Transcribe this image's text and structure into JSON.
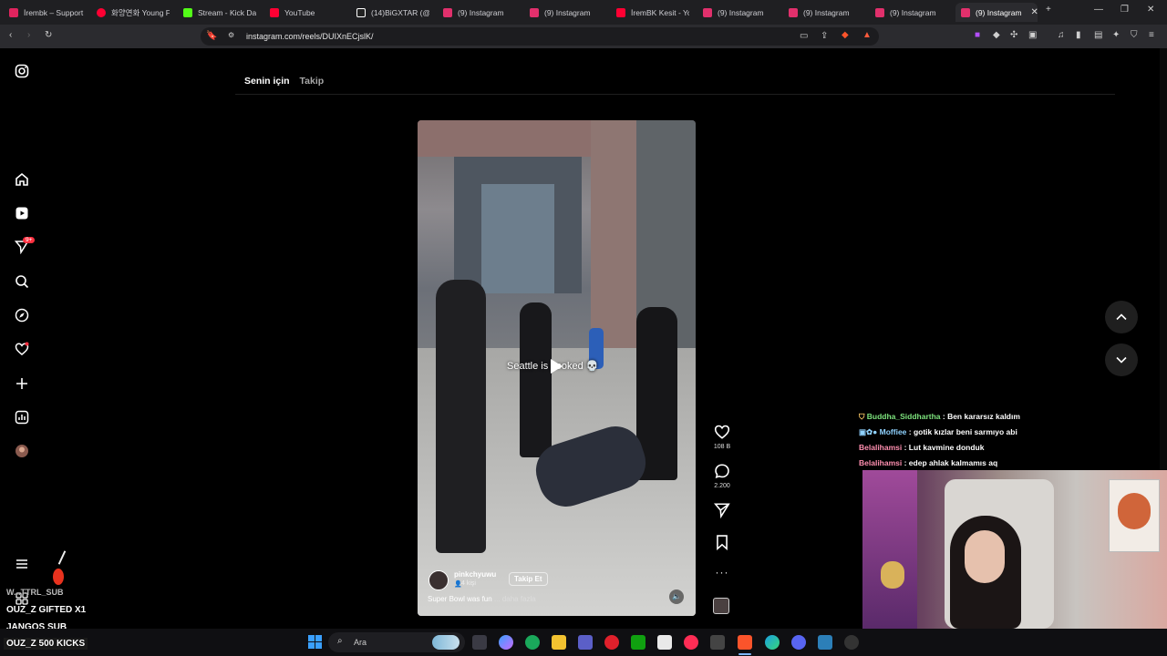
{
  "browser": {
    "tabs": [
      {
        "label": "İrembk – Support",
        "color": "#e0245e"
      },
      {
        "label": "화양연화 Young F",
        "color": "#ff0033"
      },
      {
        "label": "Stream - Kick Da",
        "color": "#53fc18"
      },
      {
        "label": "YouTube",
        "color": "#ff0033"
      },
      {
        "label": "(14)BiGXTAR (@b",
        "color": "#ffffff"
      },
      {
        "label": "(9) Instagram",
        "color": "#e1306c"
      },
      {
        "label": "(9) Instagram",
        "color": "#e1306c"
      },
      {
        "label": "İremBK Kesit - Yo",
        "color": "#ff0033"
      },
      {
        "label": "(9) Instagram",
        "color": "#e1306c"
      },
      {
        "label": "(9) Instagram",
        "color": "#e1306c"
      },
      {
        "label": "(9) Instagram",
        "color": "#e1306c"
      },
      {
        "label": "(9) Instagram",
        "color": "#e1306c"
      }
    ],
    "url": "instagram.com/reels/DUIXnECjslK/"
  },
  "instagram": {
    "feed_tabs": [
      "Senin için",
      "Takip"
    ],
    "notification_badge": "9+",
    "reel": {
      "overlay_text": "Seattle is cooked 💀",
      "username": "pinkchyuwu",
      "viewers": "4 kişi",
      "follow_label": "Takip Et",
      "caption": "Super Bowl was fun",
      "more_label": "... daha fazla",
      "likes": "108 B",
      "comments": "2.200"
    }
  },
  "chat": [
    {
      "user": "Buddha_Siddhartha",
      "message": " : Ben kararsız kaldım"
    },
    {
      "user": "Moffiee",
      "message": " : gotik kızlar beni sarmıyo abi"
    },
    {
      "user": "Belalihamsi",
      "message": " : Lut kavmine donduk"
    },
    {
      "user": "Belalihamsi",
      "message": " : edep ahlak kalmamıs aq"
    }
  ],
  "stream_overlay": {
    "line1": "W...TTRL_SUB",
    "line2": "OUZ_Z  GIFTED X1",
    "line3": "JANGOS  SUB",
    "line4": "OUZ_Z  500 KICKS"
  },
  "taskbar": {
    "search_label": "Ara"
  },
  "colors": {
    "instagram_badge": "#ff3040",
    "chat_user_green": "#7de37d",
    "chat_user_blue": "#8fd2ff",
    "chat_user_pink": "#ff8fb0"
  }
}
